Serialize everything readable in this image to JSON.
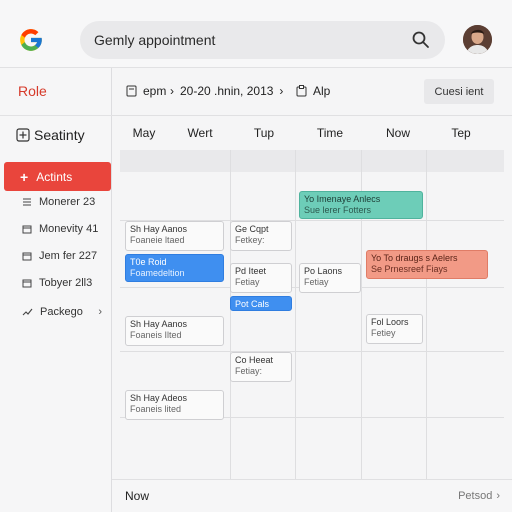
{
  "search": {
    "text": "Gemly appointment"
  },
  "sidebar": {
    "role": "Role",
    "settings": "Seatinty",
    "actions": "Actints",
    "items": [
      {
        "label": "Monerer 23",
        "icon": "list-icon"
      },
      {
        "label": "Monevity 41",
        "icon": "calendar-icon"
      },
      {
        "label": "Jem fer 227",
        "icon": "calendar-icon"
      },
      {
        "label": "Tobyer 2ll3",
        "icon": "calendar-icon"
      },
      {
        "label": "Packego",
        "icon": "trend-icon"
      }
    ]
  },
  "toolbar": {
    "item1": "epm",
    "date": "20-20 .hnin, 2013",
    "item3": "Alp",
    "current": "Cuesi ient"
  },
  "days": [
    "May",
    "Wert",
    "Tup",
    "Time",
    "Now",
    "Tep"
  ],
  "events": [
    {
      "t": "Yo Imenaye Anlecs",
      "s": "Sue lerer Fotters"
    },
    {
      "t": "Sh Hay Aanos",
      "s": "Foaneie ltaed"
    },
    {
      "t": "Ge Cqpt",
      "s": "Fetkey:"
    },
    {
      "t": "T0e Roid",
      "s": "Foamedeltion"
    },
    {
      "t": "Pd Iteet",
      "s": "Fetiay"
    },
    {
      "t": "Po Laons",
      "s": "Fetiay"
    },
    {
      "t": "Yo To draugs s Aelers",
      "s": "Se Prnesreef Fiays"
    },
    {
      "t": "Pot Cals",
      "s": ""
    },
    {
      "t": "Sh Hay Aanos",
      "s": "Foaneis Ilted"
    },
    {
      "t": "Fol Loors",
      "s": "Fetiey"
    },
    {
      "t": "Co Heeat",
      "s": "Fetiay:"
    },
    {
      "t": "Sh Hay Adeos",
      "s": "Foaneis lited"
    }
  ],
  "footer": {
    "now": "Now",
    "period": "Petsod",
    "chevron": "›"
  },
  "colors": {
    "accent": "#e9453c",
    "blue": "#3f8ff0",
    "teal": "#6dcdb8",
    "salmon": "#f29a86",
    "role": "#d63a2a"
  }
}
